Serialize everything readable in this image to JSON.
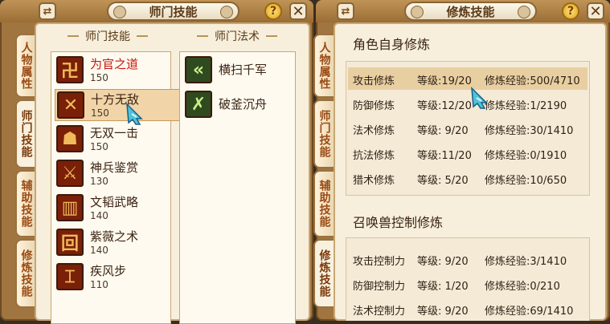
{
  "left_window": {
    "title": "师门技能",
    "side_tabs": [
      "人物属性",
      "师门技能",
      "辅助技能",
      "修炼技能"
    ],
    "skills_header": "师门技能",
    "spells_header": "师门法术",
    "skills": [
      {
        "name": "为官之道",
        "level": "150",
        "glyph": "卍"
      },
      {
        "name": "十方无敌",
        "level": "150",
        "glyph": "✕"
      },
      {
        "name": "无双一击",
        "level": "150",
        "glyph": "☗"
      },
      {
        "name": "神兵鉴赏",
        "level": "130",
        "glyph": "⚔"
      },
      {
        "name": "文韬武略",
        "level": "140",
        "glyph": "▥"
      },
      {
        "name": "紫薇之术",
        "level": "140",
        "glyph": "回"
      },
      {
        "name": "疾风步",
        "level": "110",
        "glyph": "⌶"
      }
    ],
    "spells": [
      {
        "name": "横扫千军",
        "glyph": "«"
      },
      {
        "name": "破釜沉舟",
        "glyph": "✗"
      }
    ]
  },
  "right_window": {
    "title": "修炼技能",
    "side_tabs": [
      "人物属性",
      "师门技能",
      "辅助技能",
      "修炼技能"
    ],
    "self_section_title": "角色自身修炼",
    "self_rows": [
      {
        "name": "攻击修炼",
        "level": "等级:19/20",
        "exp": "修炼经验:500/4710"
      },
      {
        "name": "防御修炼",
        "level": "等级:12/20",
        "exp": "修炼经验:1/2190"
      },
      {
        "name": "法术修炼",
        "level": "等级: 9/20",
        "exp": "修炼经验:30/1410"
      },
      {
        "name": "抗法修炼",
        "level": "等级:11/20",
        "exp": "修炼经验:0/1910"
      },
      {
        "name": "猎术修炼",
        "level": "等级: 5/20",
        "exp": "修炼经验:10/650"
      }
    ],
    "pet_section_title": "召唤兽控制修炼",
    "pet_rows": [
      {
        "name": "攻击控制力",
        "level": "等级: 9/20",
        "exp": "修炼经验:3/1410"
      },
      {
        "name": "防御控制力",
        "level": "等级: 1/20",
        "exp": "修炼经验:0/210"
      },
      {
        "name": "法术控制力",
        "level": "等级: 9/20",
        "exp": "修炼经验:69/1410"
      }
    ]
  },
  "icons": {
    "switch": "⇄",
    "help": "?",
    "close": "✕"
  }
}
